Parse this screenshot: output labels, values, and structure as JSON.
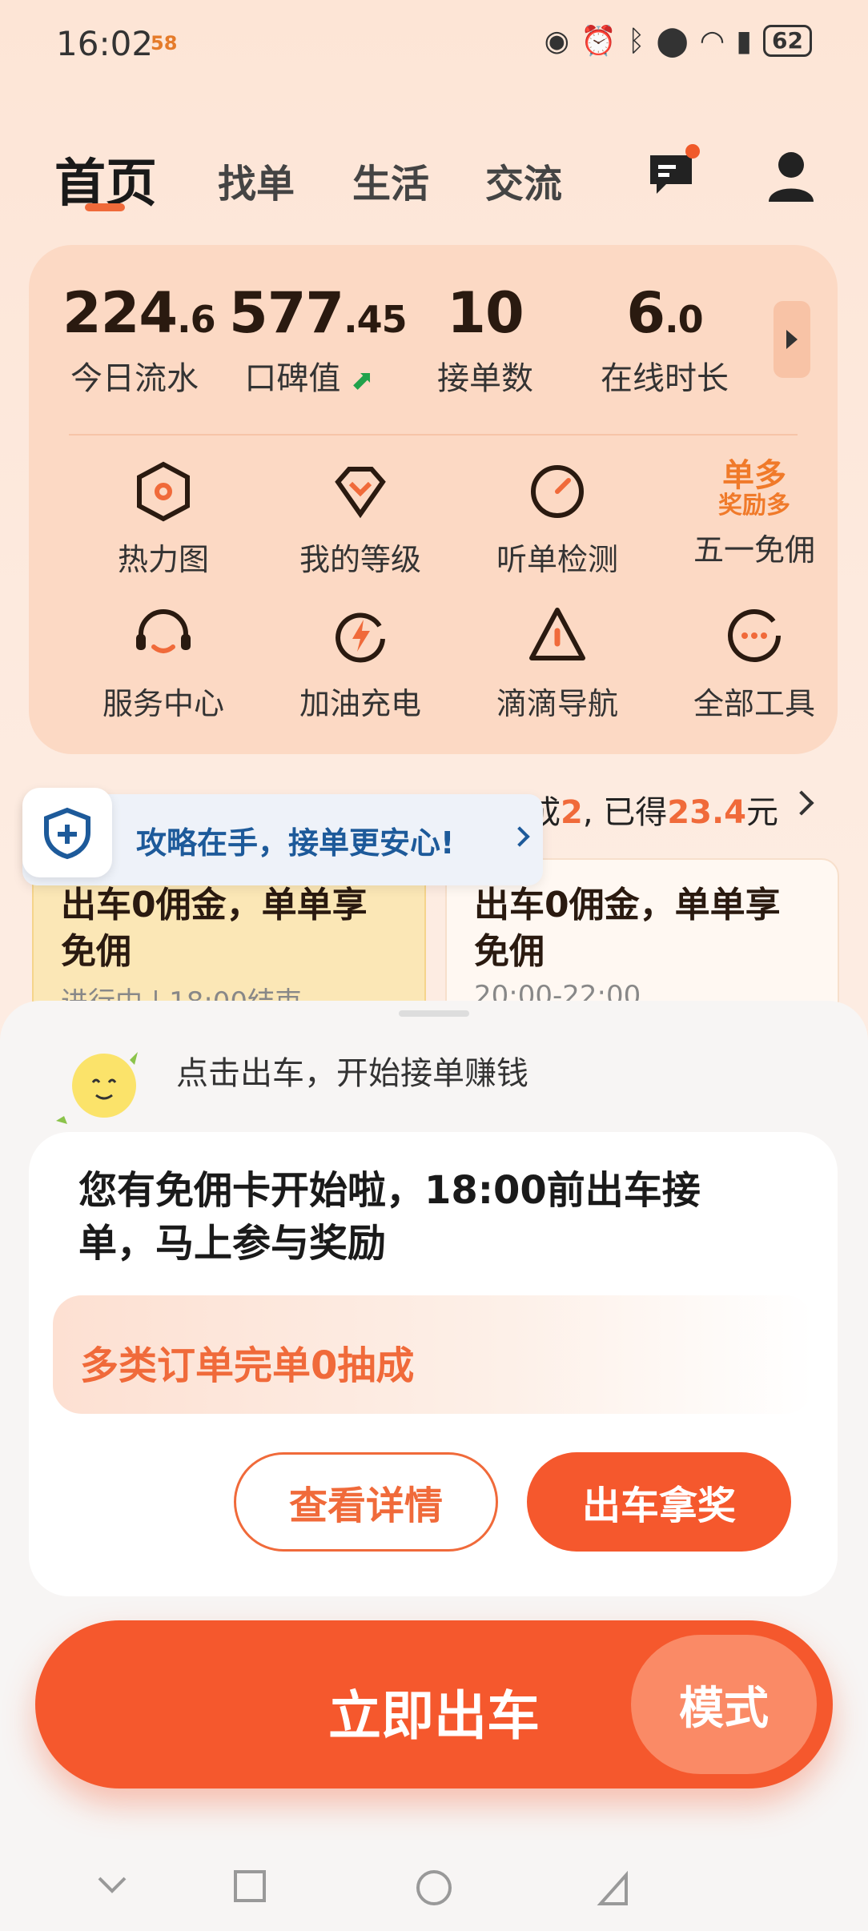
{
  "status_bar": {
    "time": "16:02",
    "badge": "58",
    "battery": "62"
  },
  "nav": {
    "tabs": [
      "首页",
      "找单",
      "生活",
      "交流"
    ]
  },
  "stats": [
    {
      "value_int": "224",
      "value_dec": ".6",
      "label": "今日流水"
    },
    {
      "value_int": "577",
      "value_dec": ".45",
      "label": "口碑值"
    },
    {
      "value_int": "10",
      "value_dec": "",
      "label": "接单数"
    },
    {
      "value_int": "6",
      "value_dec": ".0",
      "label": "在线时长"
    }
  ],
  "tools": [
    {
      "label": "热力图",
      "icon": "heatmap-icon"
    },
    {
      "label": "我的等级",
      "icon": "level-icon"
    },
    {
      "label": "听单检测",
      "icon": "gauge-icon"
    },
    {
      "label": "五一免佣",
      "icon": "promo-badge",
      "badge_line1": "单多",
      "badge_line2": "奖励多"
    },
    {
      "label": "服务中心",
      "icon": "headset-icon"
    },
    {
      "label": "加油充电",
      "icon": "charge-icon"
    },
    {
      "label": "滴滴导航",
      "icon": "navigation-icon"
    },
    {
      "label": "全部工具",
      "icon": "more-icon"
    }
  ],
  "promo": {
    "header_prefix": "成",
    "header_count": "2",
    "header_mid": ", 已得",
    "header_amount": "23.4",
    "header_suffix": "元",
    "cards": [
      {
        "title": "出车0佣金，单单享免佣",
        "sub": "进行中 | 18:00结束"
      },
      {
        "title": "出车0佣金，单单享免佣",
        "sub": "20:00-22:00"
      }
    ]
  },
  "toast": {
    "text": "攻略在手，接单更安心!"
  },
  "sheet": {
    "hint": "点击出车，开始接单赚钱",
    "offer_title": "您有免佣卡开始啦，18:00前出车接单，马上参与奖励",
    "offer_strip": "多类订单完单0抽成",
    "details_button": "查看详情",
    "claim_button": "出车拿奖",
    "go_button": "立即出车",
    "mode_button": "模式"
  },
  "colors": {
    "accent": "#f5582d",
    "card_bg": "#fcd9c4",
    "toast_text": "#1d5a9a"
  }
}
